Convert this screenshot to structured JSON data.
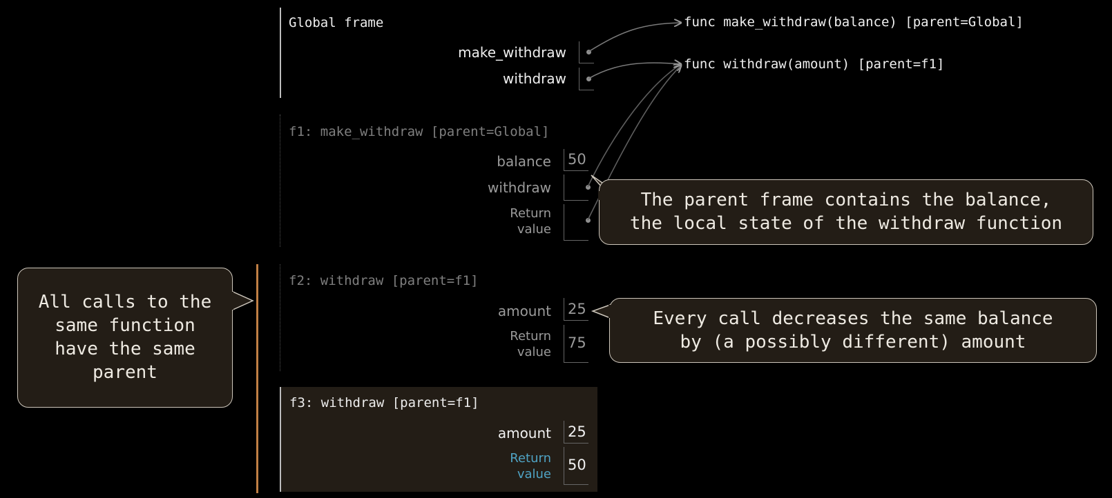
{
  "global_frame": {
    "title": "Global frame",
    "vars": [
      {
        "name": "make_withdraw"
      },
      {
        "name": "withdraw"
      }
    ]
  },
  "functions": [
    {
      "text": "func make_withdraw(balance) [parent=Global]"
    },
    {
      "text": "func withdraw(amount) [parent=f1]"
    }
  ],
  "f1": {
    "title": "f1: make_withdraw [parent=Global]",
    "balance_label": "balance",
    "balance_value": "50",
    "withdraw_label": "withdraw",
    "return_label_1": "Return",
    "return_label_2": "value"
  },
  "f2": {
    "title": "f2: withdraw [parent=f1]",
    "amount_label": "amount",
    "amount_value": "25",
    "return_label_1": "Return",
    "return_label_2": "value",
    "return_value": "75"
  },
  "f3": {
    "title": "f3: withdraw [parent=f1]",
    "amount_label": "amount",
    "amount_value": "25",
    "return_label_1": "Return",
    "return_label_2": "value",
    "return_value": "50"
  },
  "callouts": {
    "parent_frame": [
      "The parent frame contains the balance,",
      "the local state of the withdraw function"
    ],
    "every_call": [
      "Every call decreases the same balance",
      "by (a possibly different) amount"
    ],
    "same_parent": [
      "All calls to the",
      "same function",
      "have the same",
      "parent"
    ]
  },
  "colors": {
    "background": "#000000",
    "highlight_frame": "#231d16",
    "accent_bar": "#c17f45",
    "return_label_active": "#4fa3c4"
  }
}
